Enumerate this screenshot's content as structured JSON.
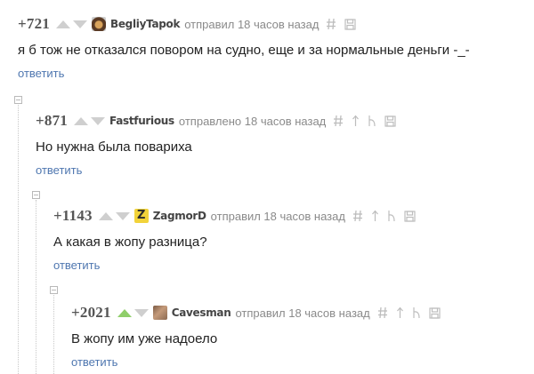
{
  "comments": [
    {
      "rating": "+721",
      "avatar": "",
      "user": "BegliyTapok",
      "action": "отправил 18 часов назад",
      "text": "я б тож не отказался повором на судно, еще и за нормальные деньги -_-",
      "reply": "ответить"
    },
    {
      "rating": "+871",
      "avatar": "",
      "user": "Fastfurious",
      "action": "отправлено 18 часов назад",
      "text": "Но нужна была повариха",
      "reply": "ответить"
    },
    {
      "rating": "+1143",
      "avatar": "Z",
      "user": "ZagmorD",
      "action": "отправил 18 часов назад",
      "text": "А какая в жопу разница?",
      "reply": "ответить"
    },
    {
      "rating": "+2021",
      "avatar": "",
      "user": "Cavesman",
      "action": "отправил 18 часов назад",
      "text": "В жопу им уже надоело",
      "reply": "ответить"
    }
  ],
  "icons": {
    "link": "hash-icon",
    "save": "save-icon",
    "parent": "arrow-up-icon",
    "branch": "branch-icon",
    "collapse": "collapse-icon",
    "upvote": "upvote-icon",
    "downvote": "downvote-icon"
  },
  "colors": {
    "reply_link": "#4f77b0",
    "upvote_active": "#8fce6a",
    "vote_inactive": "#cfcfcf"
  }
}
